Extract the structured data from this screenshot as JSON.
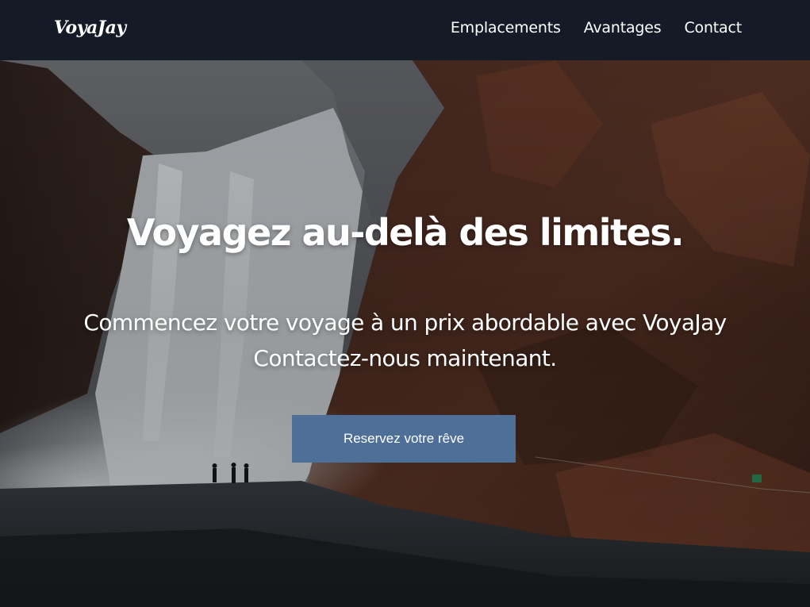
{
  "navbar": {
    "logo": "VoyaJay",
    "links": [
      "Emplacements",
      "Avantages",
      "Contact"
    ]
  },
  "hero": {
    "title": "Voyagez au-delà des limites.",
    "subtitle_line1": "Commencez votre voyage à un prix abordable avec VoyaJay",
    "subtitle_line2": "Contactez-nous maintenant.",
    "cta_label": "Reservez votre rêve",
    "background_image": "waterfall-landscape"
  },
  "colors": {
    "navbar_bg": "#141b26",
    "cta_bg": "#4e6f98",
    "text": "#ffffff"
  }
}
